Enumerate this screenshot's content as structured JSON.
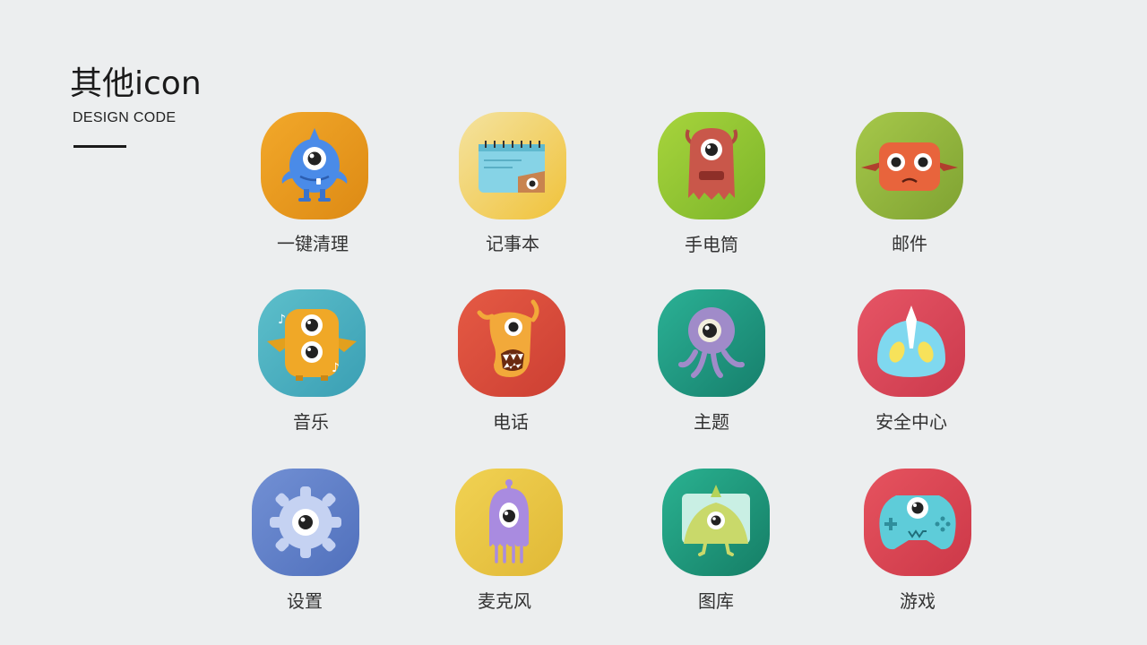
{
  "header": {
    "title": "其他icon",
    "subtitle": "DESIGN CODE"
  },
  "icons": [
    {
      "label": "一键清理",
      "icon": "cleanup-monster-icon",
      "color": "#E89A1C"
    },
    {
      "label": "记事本",
      "icon": "notepad-monster-icon",
      "color": "#F1C93F"
    },
    {
      "label": "手电筒",
      "icon": "flashlight-monster-icon",
      "color": "#8EC735"
    },
    {
      "label": "邮件",
      "icon": "mail-monster-icon",
      "color": "#8CAE3A"
    },
    {
      "label": "音乐",
      "icon": "music-monster-icon",
      "color": "#43AFC0"
    },
    {
      "label": "电话",
      "icon": "phone-monster-icon",
      "color": "#DB4A3B"
    },
    {
      "label": "主题",
      "icon": "theme-monster-icon",
      "color": "#1F9A83"
    },
    {
      "label": "安全中心",
      "icon": "security-monster-icon",
      "color": "#D9445A"
    },
    {
      "label": "设置",
      "icon": "settings-monster-icon",
      "color": "#5E7BC7"
    },
    {
      "label": "麦克风",
      "icon": "microphone-monster-icon",
      "color": "#E8C544"
    },
    {
      "label": "图库",
      "icon": "gallery-monster-icon",
      "color": "#1E9A7C"
    },
    {
      "label": "游戏",
      "icon": "game-monster-icon",
      "color": "#DD4656"
    }
  ]
}
